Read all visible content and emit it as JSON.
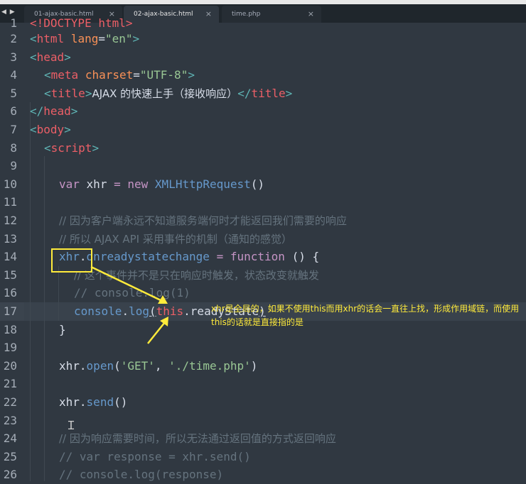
{
  "tabs": [
    {
      "label": "01-ajax-basic.html",
      "close": "×",
      "active": false
    },
    {
      "label": "02-ajax-basic.html",
      "close": "×",
      "active": true
    },
    {
      "label": "time.php",
      "close": "×",
      "active": false
    }
  ],
  "nav_arrows": "◀ ▶",
  "line_numbers": [
    "1",
    "2",
    "3",
    "4",
    "5",
    "6",
    "7",
    "8",
    "9",
    "10",
    "11",
    "12",
    "13",
    "14",
    "15",
    "16",
    "17",
    "18",
    "19",
    "20",
    "21",
    "22",
    "23",
    "24",
    "25",
    "26"
  ],
  "code": {
    "l1_doctype": "<!DOCTYPE html>",
    "l2_html": "html",
    "l2_attr": "lang",
    "l2_val": "\"en\"",
    "l3_head": "head",
    "l4_meta": "meta",
    "l4_attr": "charset",
    "l4_val": "\"UTF-8\"",
    "l5_title": "title",
    "l5_text": "AJAX 的快速上手（接收响应）",
    "l6_head": "head",
    "l7_body": "body",
    "l8_script": "script",
    "l10_var": "var",
    "l10_name": "xhr",
    "l10_new": "new",
    "l10_cls": "XMLHttpRequest",
    "l12_comment": "// 因为客户端永远不知道服务端何时才能返回我们需要的响应",
    "l13_comment": "// 所以 AJAX API 采用事件的机制（通知的感觉）",
    "l14_obj": "xhr",
    "l14_prop": "onreadystatechange",
    "l14_fn": "function",
    "l15_comment": "// 这个事件并不是只在响应时触发，状态改变就触发",
    "l16_comment": "// console.log(1)",
    "l17_console": "console",
    "l17_log": "log",
    "l17_this": "this",
    "l17_prop": "readyState",
    "l20_obj": "xhr",
    "l20_method": "open",
    "l20_arg1": "'GET'",
    "l20_arg2": "'./time.php'",
    "l22_obj": "xhr",
    "l22_method": "send",
    "l24_comment": "// 因为响应需要时间，所以无法通过返回值的方式返回响应",
    "l25_comment": "// var response = xhr.send()",
    "l26_comment": "// console.log(response)"
  },
  "annotation": {
    "text": "xhr是全局的，如果不使用this而用xhr的话会一直往上找，形成作用域链，而使用this的话就是直接指的是",
    "color": "#ffeb3b"
  },
  "colors": {
    "background": "#303841",
    "tag": "#ec5f67",
    "string": "#99c794",
    "keyword": "#c594c5",
    "function": "#6699cc",
    "comment": "#65737e"
  }
}
